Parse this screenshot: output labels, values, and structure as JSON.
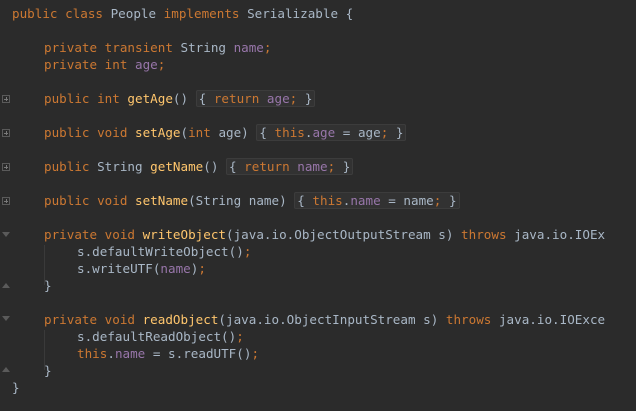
{
  "editor": {
    "lines": {
      "l1": {
        "a": "public class ",
        "b": "People ",
        "c": "implements ",
        "d": "Serializable {"
      },
      "l2": {
        "a": "private transient ",
        "b": "String ",
        "c": "name",
        "d": ";"
      },
      "l3": {
        "a": "private int ",
        "b": "age",
        "c": ";"
      },
      "l4": {
        "a": "public ",
        "b": "int ",
        "c": "getAge",
        "d": "() ",
        "e": "{ ",
        "f": "return ",
        "g": "age",
        "h": "; ",
        "i": "}"
      },
      "l5": {
        "a": "public ",
        "b": "void ",
        "c": "setAge",
        "d": "(",
        "e": "int ",
        "f": "age) ",
        "g": "{ ",
        "h": "this",
        "i": ".",
        "j": "age",
        "k": " = age",
        "l": "; ",
        "m": "}"
      },
      "l6": {
        "a": "public ",
        "b": "String ",
        "c": "getName",
        "d": "() ",
        "e": "{ ",
        "f": "return ",
        "g": "name",
        "h": "; ",
        "i": "}"
      },
      "l7": {
        "a": "public ",
        "b": "void ",
        "c": "setName",
        "d": "(String name) ",
        "e": "{ ",
        "f": "this",
        "g": ".",
        "h": "name",
        "i": " = name",
        "j": "; ",
        "k": "}"
      },
      "l8": {
        "a": "private ",
        "b": "void ",
        "c": "writeObject",
        "d": "(java.io.ObjectOutputStream s) ",
        "e": "throws ",
        "f": "java.io.IOEx"
      },
      "l9": {
        "a": "s.defaultWriteObject()",
        "b": ";"
      },
      "l10": {
        "a": "s.writeUTF(",
        "b": "name",
        "c": ")",
        "d": ";"
      },
      "l11": {
        "a": "}"
      },
      "l12": {
        "a": "private ",
        "b": "void ",
        "c": "readObject",
        "d": "(java.io.ObjectInputStream s) ",
        "e": "throws ",
        "f": "java.io.IOExce"
      },
      "l13": {
        "a": "s.defaultReadObject()",
        "b": ";"
      },
      "l14": {
        "a": "this",
        "b": ".",
        "c": "name",
        "d": " = s.readUTF()",
        "e": ";"
      },
      "l15": {
        "a": "}"
      },
      "l16": {
        "a": "}"
      }
    }
  },
  "colors": {
    "background": "#2b2b2b",
    "keyword": "#cc7832",
    "method": "#ffc66d",
    "field": "#9876aa",
    "text": "#a9b7c6"
  }
}
